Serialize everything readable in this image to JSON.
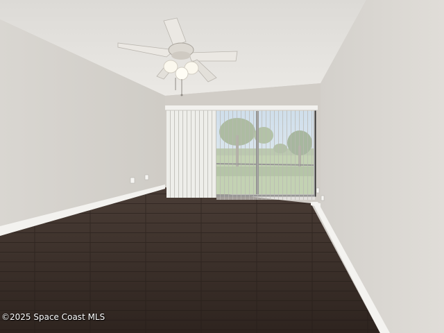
{
  "photo": {
    "subject": "empty-room",
    "watermark": "©2025 Space Coast MLS",
    "colors": {
      "ceiling": "#e4e2de",
      "wall_left": "#d6d3ce",
      "wall_right": "#dcd9d4",
      "wall_back": "#d2cec8",
      "floor": "#3a2e28",
      "baseboard": "#f4f3f0",
      "blinds": "#ecece8",
      "fan": "#e8e5e0",
      "sky": "#b8d4ea",
      "grass": "#8cae6a"
    },
    "icons": [
      "ceiling-fan-icon",
      "window-blinds-icon",
      "outlet-icon"
    ]
  }
}
